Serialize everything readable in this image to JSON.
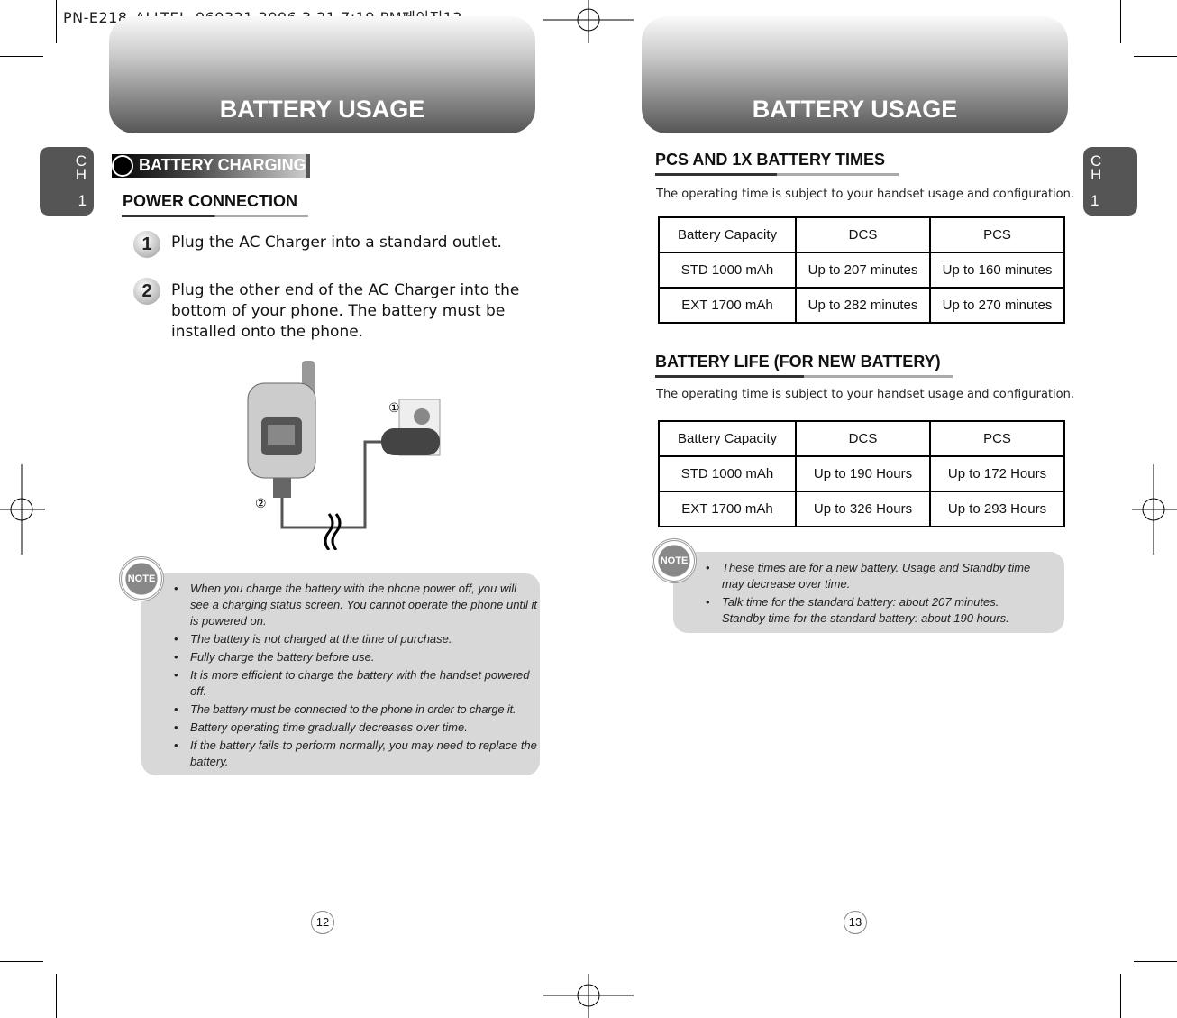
{
  "slug": "PN-E218_ALLTEL_060321  2006.3.21 7:19 PM페이지12",
  "left": {
    "banner": "BATTERY USAGE",
    "chapter": {
      "ch1": "C",
      "ch2": "H",
      "num": "1"
    },
    "section": "BATTERY CHARGING",
    "heading": "POWER CONNECTION",
    "steps": [
      {
        "num": "1",
        "text": "Plug the AC Charger into a standard outlet."
      },
      {
        "num": "2",
        "text": "Plug the other end of the AC Charger into the bottom of your phone. The battery must be installed onto the phone."
      }
    ],
    "figure_callouts": [
      "①",
      "②"
    ],
    "note_icon": "NOTE",
    "notes": [
      "When you charge the battery with the phone power off, you will see a charging status screen. You cannot operate the phone until it is powered on.",
      "The battery is not charged at the time of purchase.",
      "Fully charge the battery before use.",
      "It is more efficient to charge the battery with the handset powered off.",
      "The battery must be connected to the phone in order to charge it.",
      "Battery operating time gradually decreases over time.",
      "If the battery fails to perform normally, you may need to replace the battery."
    ],
    "page_number": "12"
  },
  "right": {
    "banner": "BATTERY USAGE",
    "chapter": {
      "ch1": "C",
      "ch2": "H",
      "num": "1"
    },
    "table1": {
      "heading": "PCS AND 1X BATTERY TIMES",
      "subtitle": "The operating time is subject to your handset usage and configuration.",
      "headers": [
        "Battery Capacity",
        "DCS",
        "PCS"
      ],
      "rows": [
        [
          "STD 1000 mAh",
          "Up to 207 minutes",
          "Up to 160 minutes"
        ],
        [
          "EXT 1700 mAh",
          "Up to 282 minutes",
          "Up to 270 minutes"
        ]
      ]
    },
    "table2": {
      "heading": "BATTERY LIFE (FOR NEW BATTERY)",
      "subtitle": "The operating time is subject to your handset usage and configuration.",
      "headers": [
        "Battery Capacity",
        "DCS",
        "PCS"
      ],
      "rows": [
        [
          "STD 1000 mAh",
          "Up to 190 Hours",
          "Up to 172 Hours"
        ],
        [
          "EXT 1700 mAh",
          "Up to 326 Hours",
          "Up to 293 Hours"
        ]
      ]
    },
    "note_icon": "NOTE",
    "notes": [
      "These times are for a new battery. Usage and Standby time may decrease over time.",
      "Talk time for the standard battery: about 207 minutes. Standby time for the standard battery: about 190 hours."
    ],
    "page_number": "13"
  }
}
